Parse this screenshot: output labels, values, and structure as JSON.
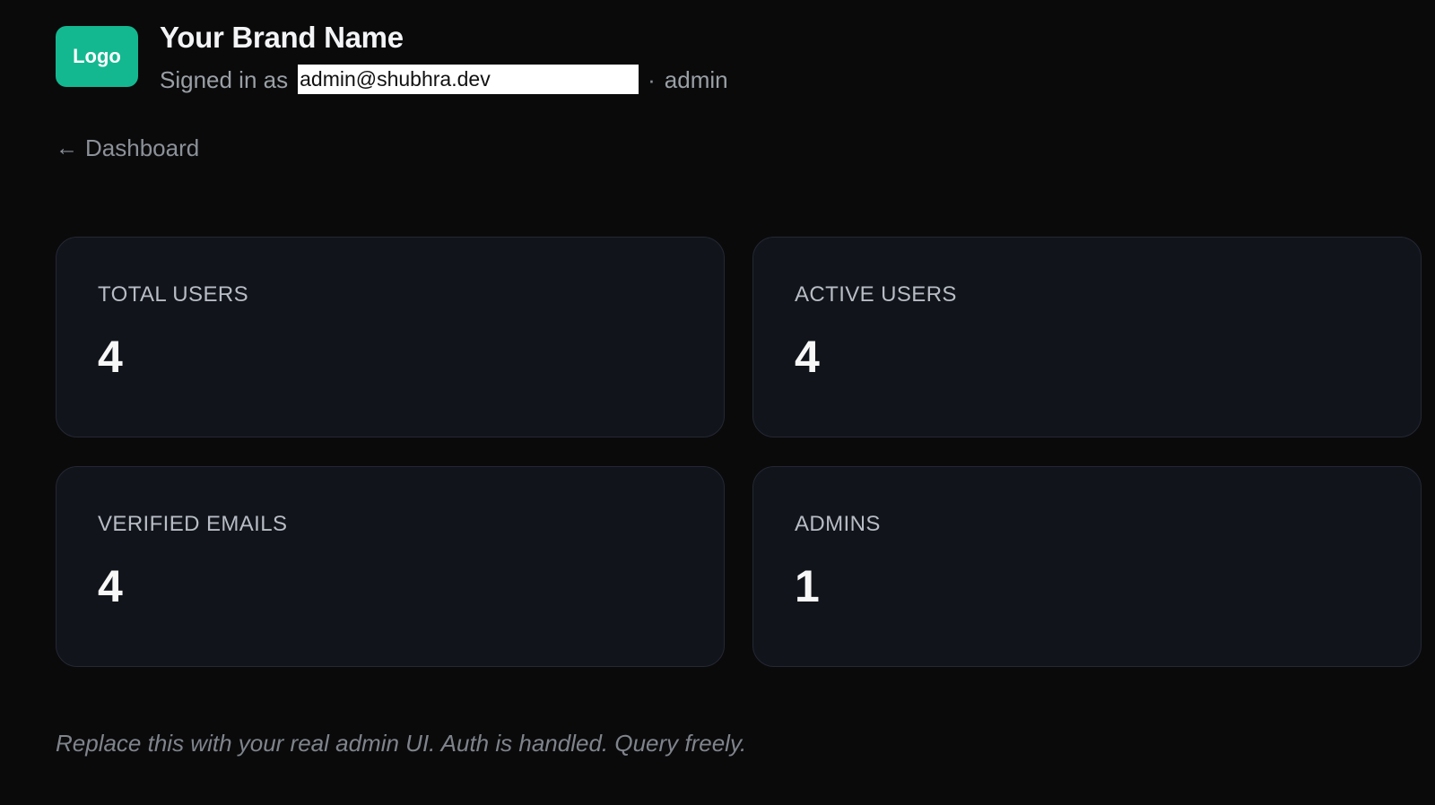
{
  "header": {
    "logo_text": "Logo",
    "brand_name": "Your Brand Name",
    "signed_in_prefix": "Signed in as",
    "email": "admin@shubhra.dev",
    "separator": "·",
    "role": "admin"
  },
  "nav": {
    "back_arrow": "←",
    "back_label": "Dashboard"
  },
  "stats": [
    {
      "label": "TOTAL USERS",
      "value": "4"
    },
    {
      "label": "ACTIVE USERS",
      "value": "4"
    },
    {
      "label": "VERIFIED EMAILS",
      "value": "4"
    },
    {
      "label": "ADMINS",
      "value": "1"
    }
  ],
  "footer": {
    "note": "Replace this with your real admin UI. Auth is handled. Query freely."
  },
  "colors": {
    "background": "#0a0a0b",
    "logo_accent": "#14b890",
    "card_background": "#11141b",
    "card_border": "#242833"
  }
}
